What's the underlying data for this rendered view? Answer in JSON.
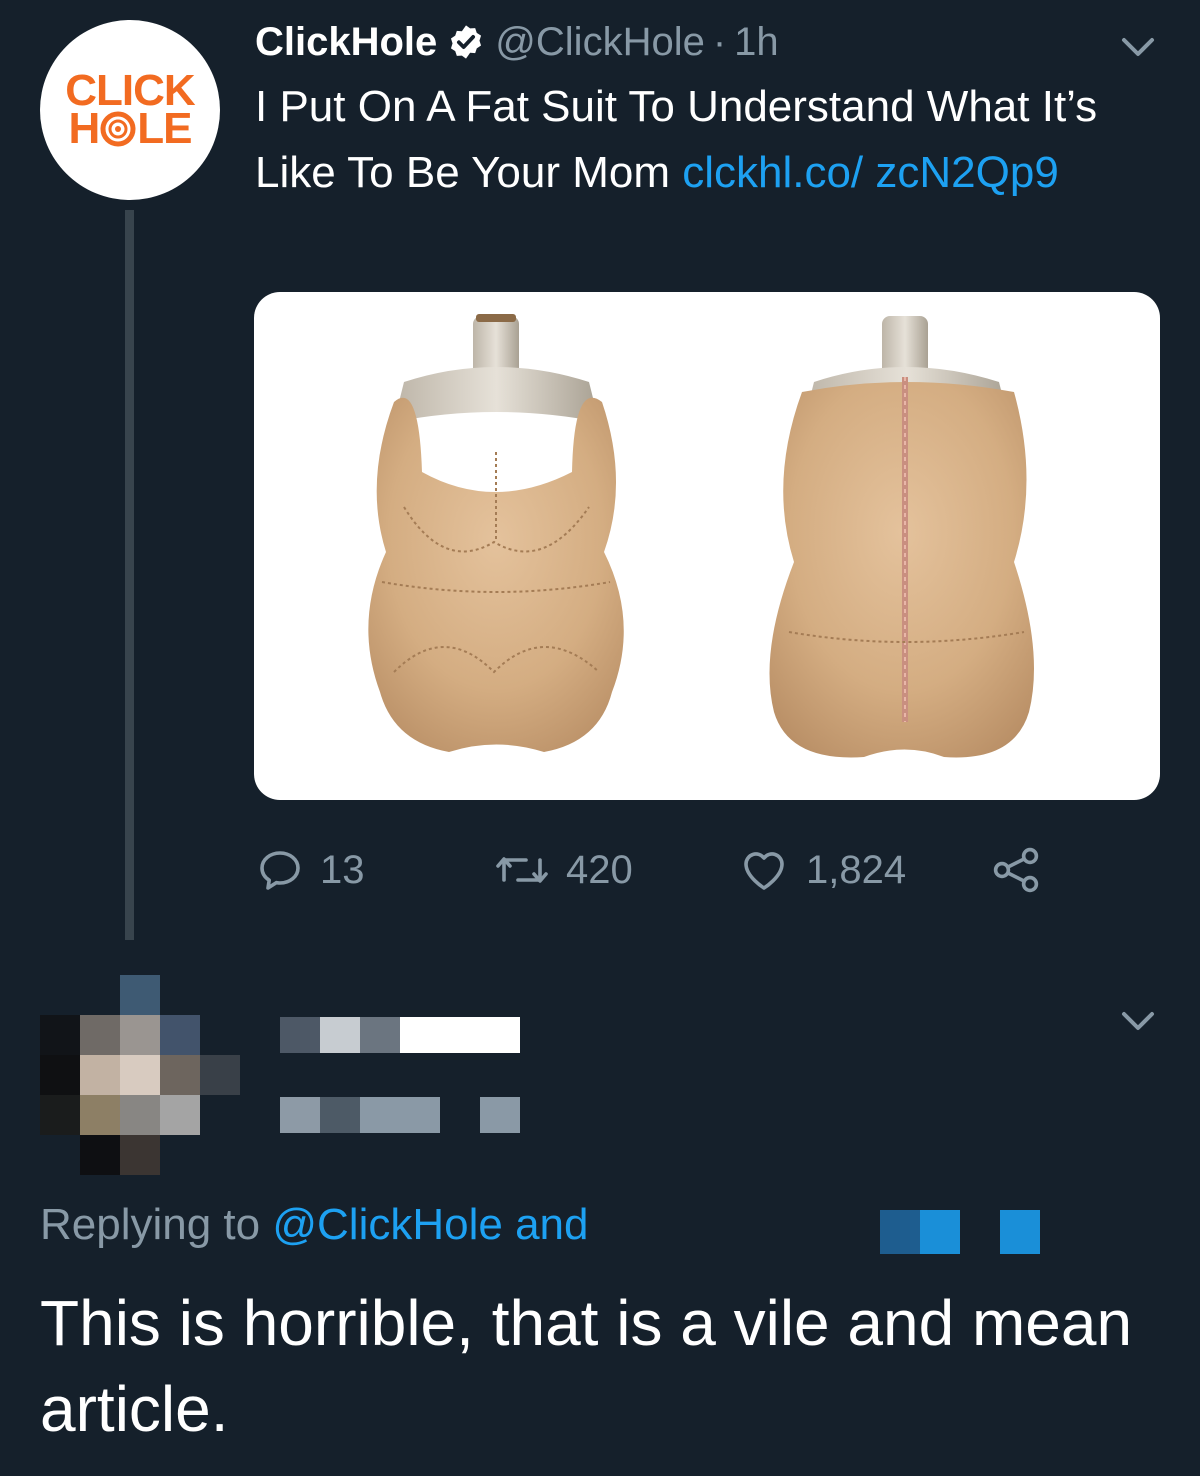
{
  "tweet": {
    "author": {
      "name": "ClickHole",
      "handle": "@ClickHole",
      "verified": true,
      "avatar_logo_top": "CLICK",
      "avatar_logo_bottom_left": "H",
      "avatar_logo_bottom_right": "LE"
    },
    "separator": "·",
    "time": "1h",
    "text": "I Put On A Fat Suit To Understand What It’s Like To Be Your Mom ",
    "link": "clckhl.co/ zcN2Qp9",
    "media_description_icon": "fat-suit-image",
    "actions": {
      "reply_count": "13",
      "retweet_count": "420",
      "like_count": "1,824"
    },
    "icons": [
      "verified-badge-icon",
      "chevron-down-icon",
      "reply-icon",
      "retweet-icon",
      "like-icon",
      "share-icon"
    ]
  },
  "reply": {
    "replying_prefix": "Replying to ",
    "replying_handle": "@ClickHole and",
    "text": "This is horrible, that is a vile and mean article."
  },
  "colors": {
    "background": "#15202b",
    "text_primary": "#ffffff",
    "text_secondary": "#8899a6",
    "link": "#1da1f2",
    "brand_orange": "#f26b21",
    "thread_line": "#38444d"
  }
}
